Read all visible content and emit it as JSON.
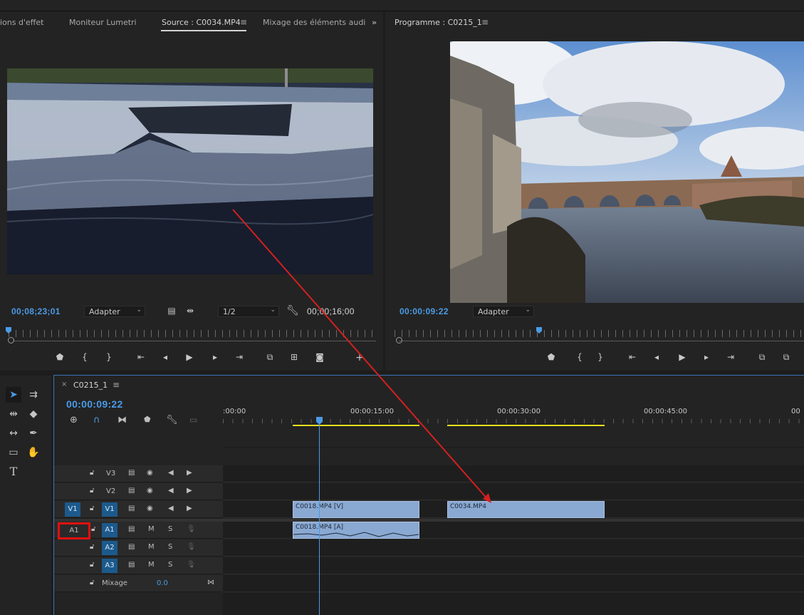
{
  "source_panel": {
    "tabs": [
      {
        "label": "ions d'effet",
        "active": false
      },
      {
        "label": "Moniteur Lumetri",
        "active": false
      },
      {
        "label": "Source : C0034.MP4",
        "active": true
      },
      {
        "label": "Mixage des éléments audi",
        "active": false
      }
    ],
    "overflow_glyph": "»",
    "menu_glyph": "≡",
    "timecode_current": "00;08;23;01",
    "fit_dropdown": "Adapter",
    "resolution_dropdown": "1/2",
    "timecode_duration": "00;00;16;00"
  },
  "program_panel": {
    "tab_label": "Programme : C0215_1",
    "menu_glyph": "≡",
    "timecode_current": "00:00:09:22",
    "fit_dropdown": "Adapter"
  },
  "timeline": {
    "sequence_tab": "C0215_1",
    "close_glyph": "×",
    "menu_glyph": "≡",
    "timecode": "00:00:09:22",
    "ruler_labels": [
      ":00:00",
      "00:00:15:00",
      "00:00:30:00",
      "00:00:45:00",
      "00"
    ],
    "video_tracks": [
      {
        "name": "V3",
        "source_patch": ""
      },
      {
        "name": "V2",
        "source_patch": ""
      },
      {
        "name": "V1",
        "source_patch": "V1"
      }
    ],
    "audio_tracks": [
      {
        "name": "A1",
        "source_patch": "A1"
      },
      {
        "name": "A2",
        "source_patch": ""
      },
      {
        "name": "A3",
        "source_patch": ""
      }
    ],
    "mute_label": "M",
    "solo_label": "S",
    "mix_label": "Mixage",
    "mix_value": "0.0",
    "clips": {
      "v1_clip1": "C0018.MP4 [V]",
      "v1_clip2": "C0034.MP4",
      "a1_clip1": "C0018.MP4 [A]"
    }
  },
  "colors": {
    "accent": "#4a9be6",
    "clip": "#8aa9d2",
    "highlight_box": "#e01010",
    "arrow": "#d42020",
    "in_out_bar": "#e8e020"
  }
}
